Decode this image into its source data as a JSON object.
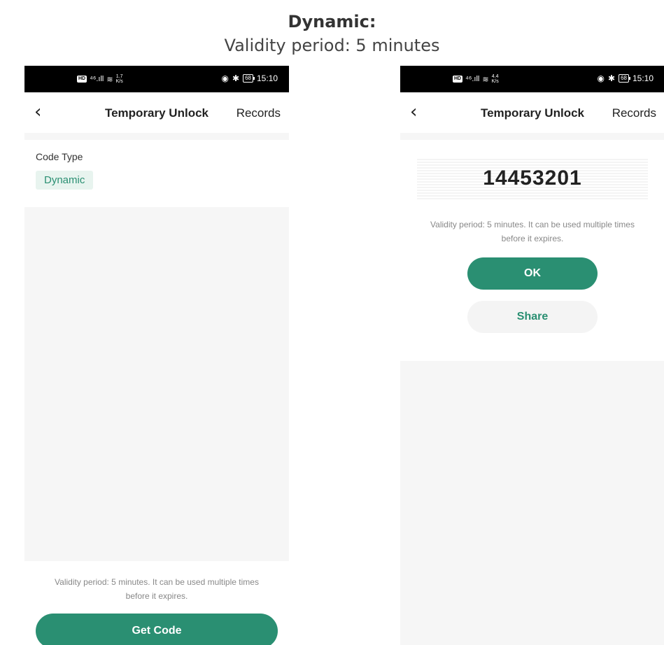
{
  "heading": {
    "title": "Dynamic:",
    "subtitle": "Validity period: 5 minutes"
  },
  "status_left": {
    "hd": "HD",
    "signal": "⁴⁶.ıll",
    "wifi": "≋",
    "speed_value": "1.7",
    "speed_unit": "K/s",
    "eye": "◉",
    "bt": "✱",
    "battery": "68",
    "time": "15:10"
  },
  "status_right": {
    "hd": "HD",
    "signal": "⁴⁶.ıll",
    "wifi": "≋",
    "speed_value": "4.4",
    "speed_unit": "K/s",
    "eye": "◉",
    "bt": "✱",
    "battery": "68",
    "time": "15:10"
  },
  "nav": {
    "back": "‹",
    "title": "Temporary Unlock",
    "records": "Records"
  },
  "left_screen": {
    "code_type_label": "Code Type",
    "code_type_value": "Dynamic",
    "hint": "Validity period: 5 minutes. It can be used multiple times before it expires.",
    "get_code": "Get Code"
  },
  "right_screen": {
    "code": "14453201",
    "hint": "Validity period: 5 minutes. It can be used multiple times before it expires.",
    "ok": "OK",
    "share": "Share"
  },
  "colors": {
    "accent": "#2a8f72",
    "chip_bg": "#e8f4ef"
  }
}
